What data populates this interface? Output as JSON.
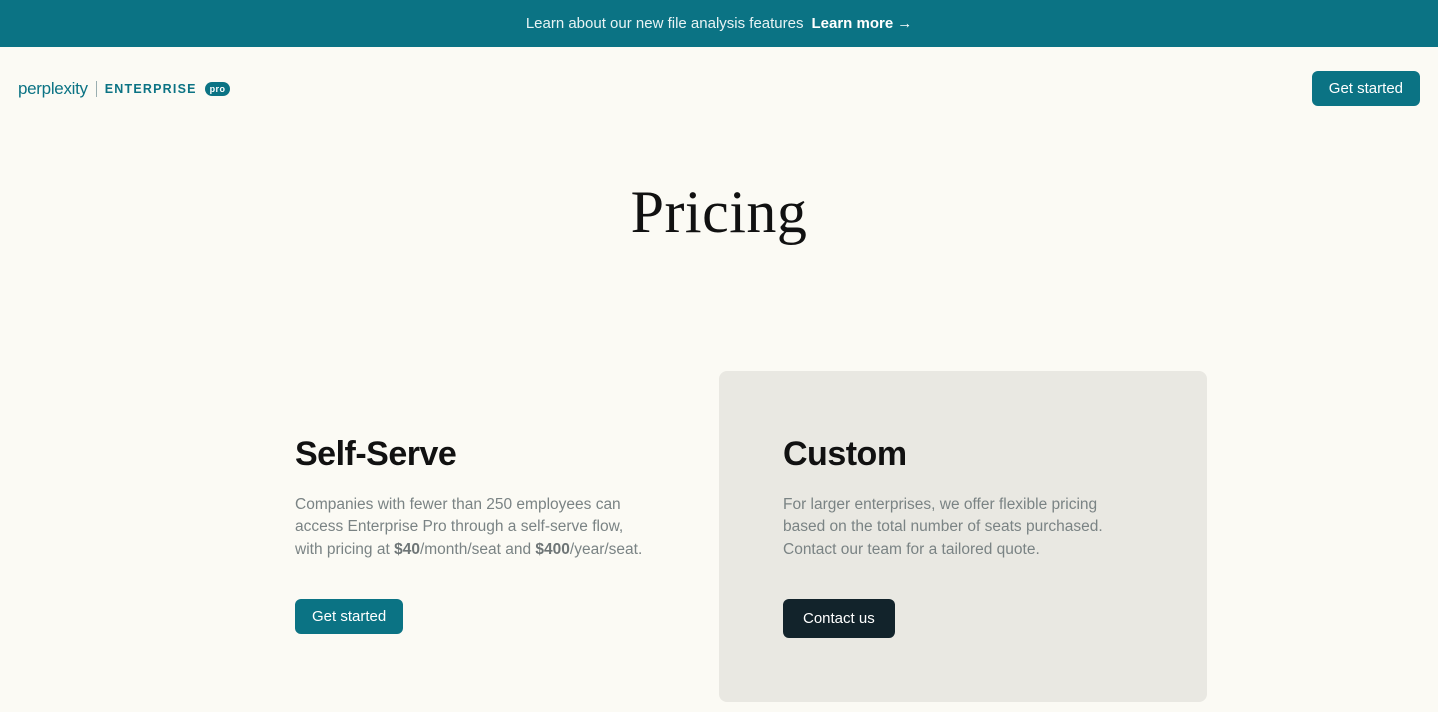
{
  "banner": {
    "text": "Learn about our new file analysis features",
    "link_label": "Learn more"
  },
  "nav": {
    "logo_perplexity": "perplexity",
    "logo_enterprise": "ENTERPRISE",
    "logo_pro": "pro",
    "get_started_label": "Get started"
  },
  "hero": {
    "title": "Pricing"
  },
  "plans": {
    "self_serve": {
      "title": "Self-Serve",
      "desc_prefix": "Companies with fewer than 250 employees can access Enterprise Pro through a self-serve flow, with pricing at ",
      "price_month": "$40",
      "desc_mid": "/month/seat and ",
      "price_year": "$400",
      "desc_suffix": "/year/seat.",
      "cta_label": "Get started"
    },
    "custom": {
      "title": "Custom",
      "desc": "For larger enterprises, we offer flexible pricing based on the total number of seats purchased. Contact our team for a tailored quote.",
      "cta_label": "Contact us"
    }
  }
}
